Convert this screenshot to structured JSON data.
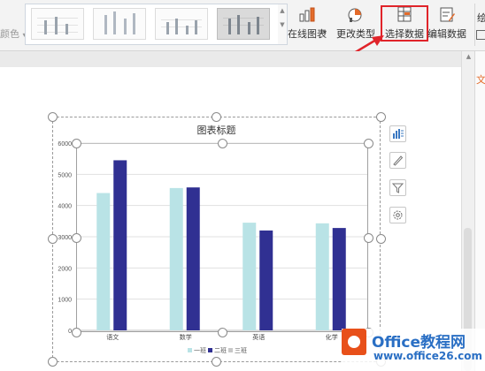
{
  "ribbon": {
    "left_partial_label": "颜色",
    "online_chart_label": "在线图表",
    "change_type_label": "更改类型",
    "select_data_label": "选择数据",
    "edit_data_label": "编辑数据",
    "right_partial_label": "绘"
  },
  "side_panel_partial_label": "文",
  "chart_data": {
    "type": "bar",
    "title": "图表标题",
    "categories": [
      "语文",
      "数学",
      "英语",
      "化学"
    ],
    "series": [
      {
        "name": "一班",
        "values": [
          4400,
          4560,
          3450,
          3430
        ],
        "color": "#b9e3e6"
      },
      {
        "name": "二班",
        "values": [
          5450,
          4580,
          3200,
          3280
        ],
        "color": "#303092"
      },
      {
        "name": "三班",
        "values": [],
        "color": "#c8c8c8"
      }
    ],
    "y_ticks": [
      "0",
      "1000",
      "2000",
      "3000",
      "4000",
      "5000",
      "6000"
    ],
    "ylim": [
      0,
      6000
    ],
    "grid": true,
    "legend_position": "bottom"
  },
  "watermark": {
    "brand": "Office教程网",
    "url": "www.office26.com"
  }
}
